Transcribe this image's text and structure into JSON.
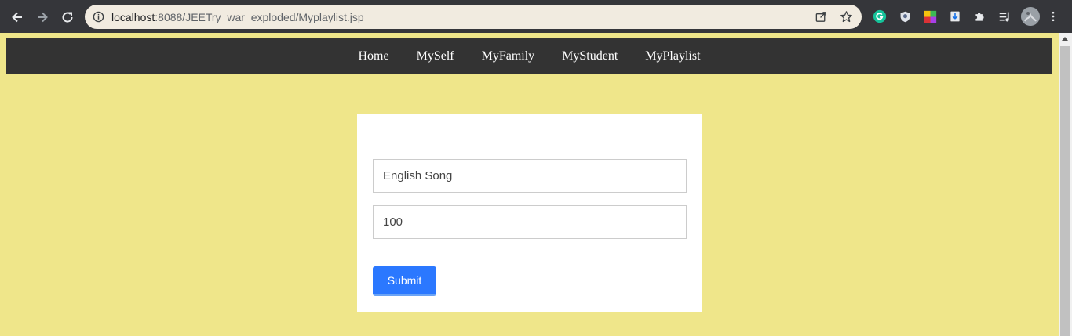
{
  "browser": {
    "url_host": "localhost",
    "url_rest": ":8088/JEETry_war_exploded/Myplaylist.jsp"
  },
  "nav": {
    "items": [
      "Home",
      "MySelf",
      "MyFamily",
      "MyStudent",
      "MyPlaylist"
    ]
  },
  "form": {
    "field1_value": "English Song",
    "field2_value": "100",
    "submit_label": "Submit"
  },
  "colors": {
    "page_bg": "#efe68a",
    "nav_bg": "#333333",
    "button": "#2b78ff"
  }
}
